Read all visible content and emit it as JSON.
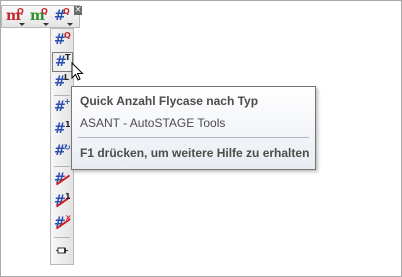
{
  "top_toolbar": {
    "buttons": [
      {
        "glyph": "m",
        "sup": "Q",
        "icon": "m-q-red-icon"
      },
      {
        "glyph": "m",
        "sup": "Q",
        "icon": "m-q-green-icon"
      },
      {
        "glyph": "#",
        "sup": "Q",
        "icon": "hash-q-icon"
      }
    ],
    "close_glyph": "×"
  },
  "vertical_toolbar": {
    "items": [
      {
        "glyph": "#",
        "sup": "Q",
        "icon": "hash-q-icon"
      },
      {
        "glyph": "#",
        "sup": "T",
        "icon": "hash-t-icon",
        "active": true
      },
      {
        "glyph": "#",
        "sup": "L",
        "icon": "hash-l-icon"
      },
      {
        "glyph": "#",
        "sup": "+",
        "icon": "hash-plus-icon"
      },
      {
        "glyph": "#",
        "sup": "1",
        "icon": "hash-one-icon"
      },
      {
        "glyph": "#",
        "sup": "↻",
        "icon": "hash-refresh-icon"
      },
      {
        "glyph": "#",
        "sup": "",
        "icon": "hash-strike-icon"
      },
      {
        "glyph": "#",
        "sup": "1",
        "icon": "hash-strike-one-icon"
      },
      {
        "glyph": "#",
        "sup": "×",
        "icon": "hash-strike-x-icon"
      }
    ],
    "pin_icon": "pin-icon"
  },
  "tooltip": {
    "title": "Quick Anzahl Flycase nach Typ",
    "subtitle": "ASANT - AutoSTAGE Tools",
    "help": "F1 drücken, um weitere Hilfe zu erhalten"
  },
  "colors": {
    "hash_blue": "#2a4fb0",
    "m_red": "#c0282c",
    "m_green": "#2f8f2f",
    "strike_red": "#d21f1f",
    "sup_color": "#c0282c"
  }
}
